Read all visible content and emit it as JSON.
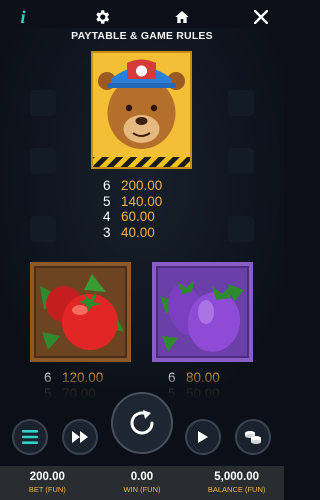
{
  "header": {
    "title": "PAYTABLE & GAME RULES",
    "info_icon": "info-icon",
    "settings_icon": "gear-icon",
    "home_icon": "home-icon",
    "close_icon": "close-icon",
    "info_glyph": "i"
  },
  "symbols": {
    "bear": {
      "icon": "bear-symbol",
      "pays": [
        {
          "count": "6",
          "amount": "200.00"
        },
        {
          "count": "5",
          "amount": "140.00"
        },
        {
          "count": "4",
          "amount": "60.00"
        },
        {
          "count": "3",
          "amount": "40.00"
        }
      ]
    },
    "tomato": {
      "icon": "tomato-symbol",
      "pays": [
        {
          "count": "6",
          "amount": "120.00"
        },
        {
          "count": "5",
          "amount": "70.00"
        }
      ]
    },
    "eggplant": {
      "icon": "eggplant-symbol",
      "pays": [
        {
          "count": "6",
          "amount": "80.00"
        },
        {
          "count": "5",
          "amount": "50.00"
        }
      ]
    }
  },
  "controls": {
    "menu_icon": "menu-icon",
    "fast_forward_icon": "fast-forward-icon",
    "spin_icon": "spin-icon",
    "play_icon": "play-icon",
    "coins_icon": "coins-icon"
  },
  "footer": {
    "bet_value": "200.00",
    "bet_label": "BET (FUN)",
    "win_value": "0.00",
    "win_label": "WIN (FUN)",
    "balance_value": "5,000.00",
    "balance_label": "BALANCE (FUN)"
  },
  "colors": {
    "accent_teal": "#2fd1c8",
    "amount_gold": "#f0b14b",
    "background": "#0b1018",
    "footer_bg": "#2a2d30"
  }
}
